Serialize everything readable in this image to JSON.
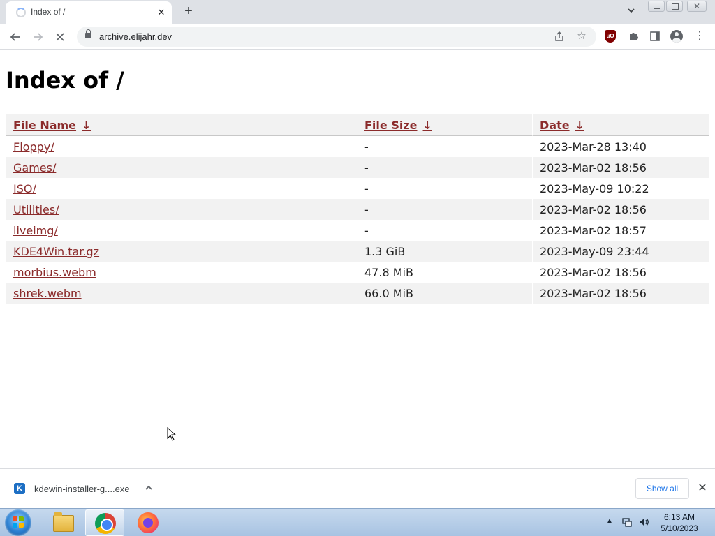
{
  "browser": {
    "tab": {
      "title": "Index of /"
    },
    "address_bar": {
      "url": "archive.elijahr.dev"
    }
  },
  "page": {
    "heading": "Index of /",
    "columns": [
      {
        "label": "File Name",
        "sort_arrow": "↓"
      },
      {
        "label": "File Size",
        "sort_arrow": "↓"
      },
      {
        "label": "Date",
        "sort_arrow": "↓"
      }
    ],
    "rows": [
      {
        "name": "Floppy/",
        "size": "-",
        "date": "2023-Mar-28 13:40"
      },
      {
        "name": "Games/",
        "size": "-",
        "date": "2023-Mar-02 18:56"
      },
      {
        "name": "ISO/",
        "size": "-",
        "date": "2023-May-09 10:22"
      },
      {
        "name": "Utilities/",
        "size": "-",
        "date": "2023-Mar-02 18:56"
      },
      {
        "name": "liveimg/",
        "size": "-",
        "date": "2023-Mar-02 18:57"
      },
      {
        "name": "KDE4Win.tar.gz",
        "size": "1.3 GiB",
        "date": "2023-May-09 23:44"
      },
      {
        "name": "morbius.webm",
        "size": "47.8 MiB",
        "date": "2023-Mar-02 18:56"
      },
      {
        "name": "shrek.webm",
        "size": "66.0 MiB",
        "date": "2023-Mar-02 18:56"
      }
    ]
  },
  "download_shelf": {
    "file_name": "kdewin-installer-g....exe",
    "show_all_label": "Show all"
  },
  "taskbar": {
    "apps": [
      "windows-explorer",
      "google-chrome",
      "firefox"
    ],
    "clock_time": "6:13 AM",
    "clock_date": "5/10/2023"
  },
  "colors": {
    "link": "#8b2b2b",
    "accent": "#1a73e8",
    "taskbar": "#b3cbe6"
  }
}
